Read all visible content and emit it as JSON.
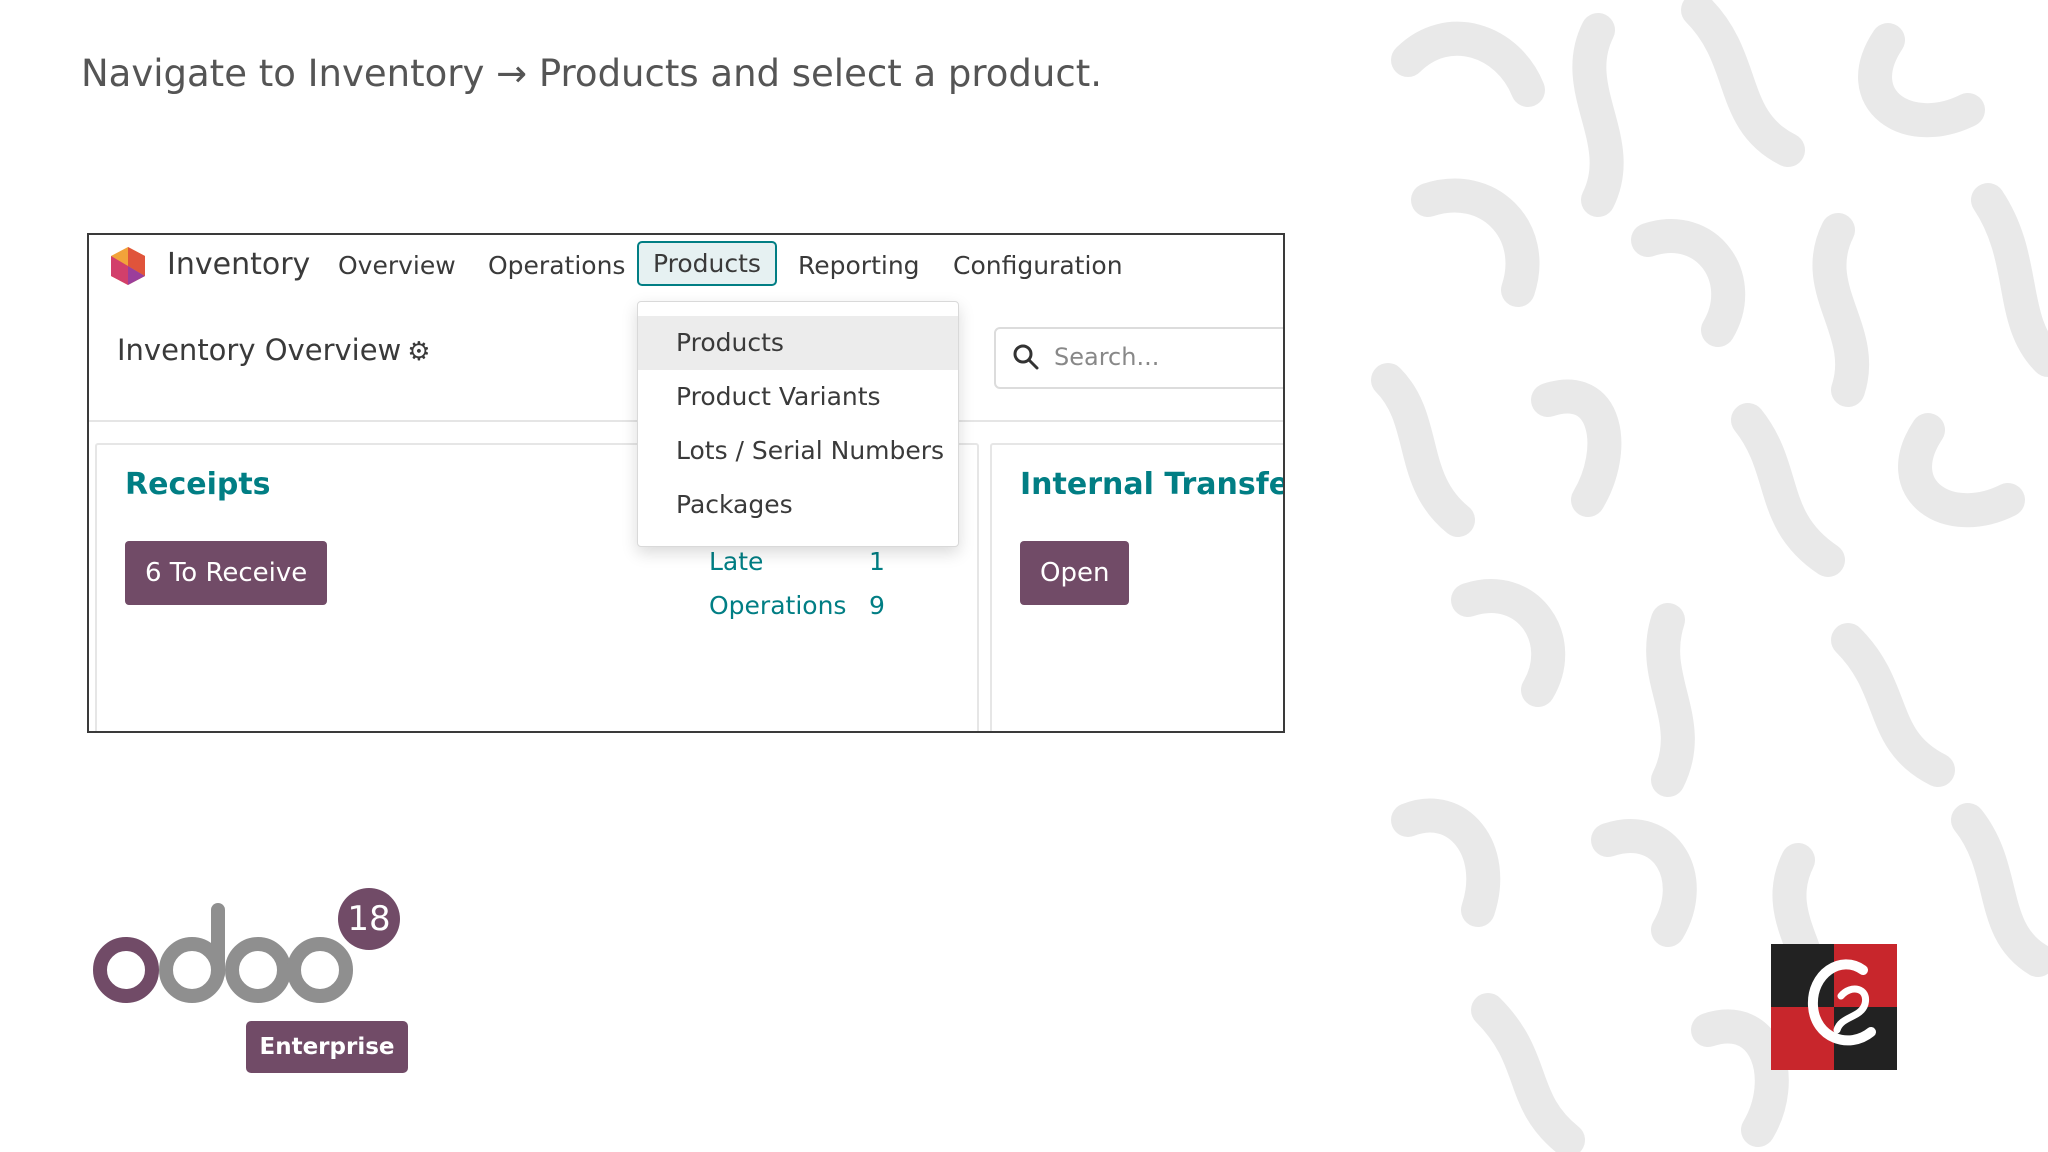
{
  "instruction": "Navigate to Inventory → Products and select a product.",
  "app": {
    "name": "Inventory",
    "nav": [
      "Overview",
      "Operations",
      "Products",
      "Reporting",
      "Configuration"
    ],
    "active_nav": "Products"
  },
  "page_title": "Inventory Overview",
  "search": {
    "placeholder": "Search..."
  },
  "products_menu": {
    "items": [
      "Products",
      "Product Variants",
      "Lots / Serial Numbers",
      "Packages"
    ],
    "hovered": "Products"
  },
  "cards": {
    "receipts": {
      "title": "Receipts",
      "button": "6 To Receive"
    },
    "middle_stats": [
      {
        "label": "Late",
        "value": "1"
      },
      {
        "label": "Operations",
        "value": "9"
      }
    ],
    "internal": {
      "title": "Internal Transfers",
      "button": "Open"
    }
  },
  "branding": {
    "version": "18",
    "edition": "Enterprise",
    "accent": "#714b67",
    "teal": "#017e84"
  }
}
